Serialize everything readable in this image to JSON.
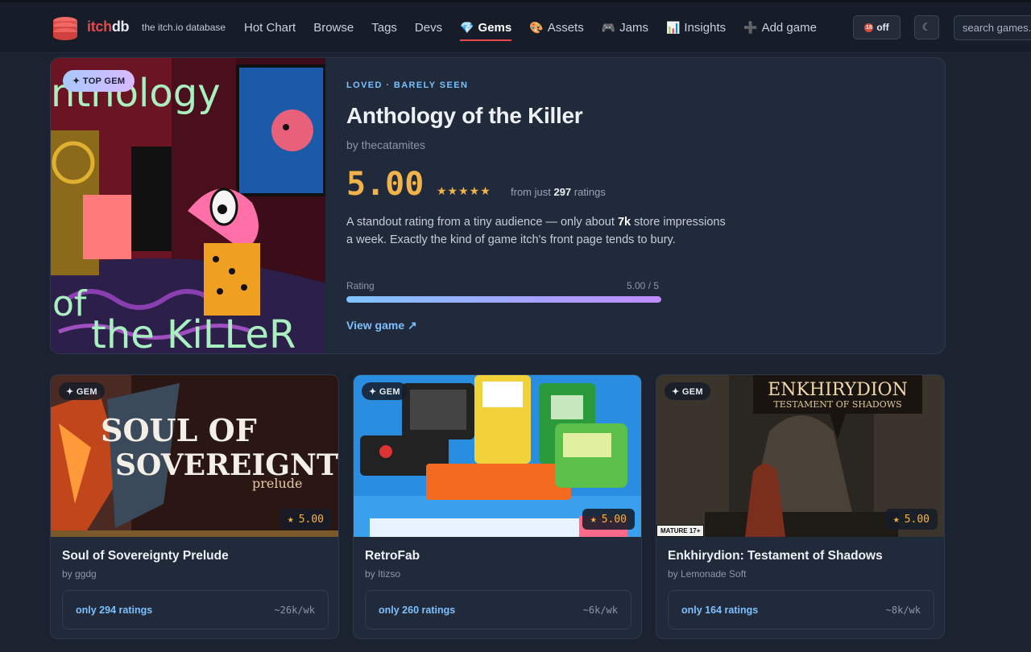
{
  "nav": {
    "brand_a": "itch",
    "brand_b": "db",
    "tagline": "the itch.io database",
    "links": [
      {
        "label": "Hot Chart",
        "icon": ""
      },
      {
        "label": "Browse",
        "icon": ""
      },
      {
        "label": "Tags",
        "icon": ""
      },
      {
        "label": "Devs",
        "icon": ""
      },
      {
        "label": "Gems",
        "icon": "💎",
        "active": true
      },
      {
        "label": "Assets",
        "icon": "🎨"
      },
      {
        "label": "Jams",
        "icon": "🎮"
      },
      {
        "label": "Insights",
        "icon": "📊"
      },
      {
        "label": "Add game",
        "icon": "➕"
      }
    ],
    "nsfw_toggle": "off",
    "nsfw_icon": "18",
    "theme_icon": "☾",
    "search_placeholder": "search games..."
  },
  "hero": {
    "badge": "✦ TOP GEM",
    "kicker": "LOVED · BARELY SEEN",
    "title": "Anthology of the Killer",
    "by": "by thecatamites",
    "score": "5.00",
    "stars": "★★★★★",
    "ratings_prefix": "from just",
    "ratings_count": "297",
    "ratings_suffix": "ratings",
    "desc_a": "A standout rating from a tiny audience — only about",
    "desc_b": "7k",
    "desc_c": "store impressions a week. Exactly the kind of game itch's front page tends to bury.",
    "rating_label": "Rating",
    "rating_value": "5.00 / 5",
    "rating_fraction": 1.0,
    "view_link": "View game ↗",
    "art_text_top": "nthology",
    "art_text_of": "of",
    "art_text_bottom": "the KiLLeR"
  },
  "cards": [
    {
      "badge": "✦ GEM",
      "score": "5.00",
      "title": "Soul of Sovereignty Prelude",
      "by": "by ggdg",
      "ratings": "only 294 ratings",
      "weekly": "~26k/wk",
      "art_line1": "SOUL OF",
      "art_line2": "SOVEREIGNTY",
      "art_line3": "prelude"
    },
    {
      "badge": "✦ GEM",
      "score": "5.00",
      "title": "RetroFab",
      "by": "by Itizso",
      "ratings": "only 260 ratings",
      "weekly": "~6k/wk"
    },
    {
      "badge": "✦ GEM",
      "score": "5.00",
      "title": "Enkhirydion: Testament of Shadows",
      "by": "by Lemonade Soft",
      "ratings": "only 164 ratings",
      "weekly": "~8k/wk",
      "art_line1": "ENKHIRYDION",
      "art_line2": "TESTAMENT OF SHADOWS",
      "mature": "MATURE 17+"
    }
  ]
}
